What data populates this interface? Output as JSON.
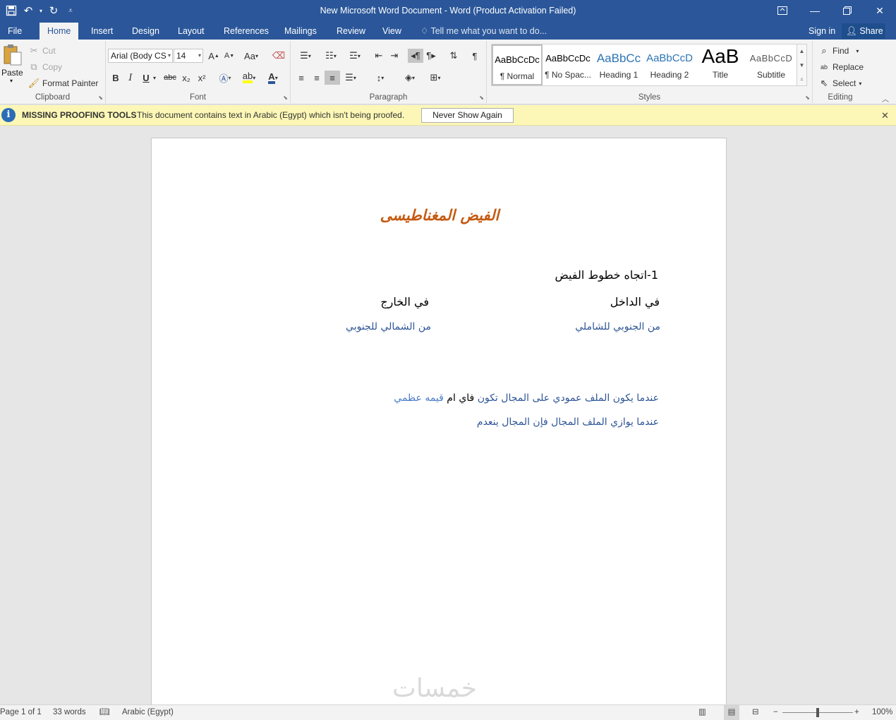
{
  "titlebar": {
    "title": "New Microsoft Word Document - Word (Product Activation Failed)",
    "qat": {
      "save_icon": "save-icon",
      "undo_icon": "undo-icon",
      "redo_icon": "redo-icon",
      "customize_icon": "customize-qat-icon"
    }
  },
  "tabs": [
    {
      "label": "File"
    },
    {
      "label": "Home"
    },
    {
      "label": "Insert"
    },
    {
      "label": "Design"
    },
    {
      "label": "Layout"
    },
    {
      "label": "References"
    },
    {
      "label": "Mailings"
    },
    {
      "label": "Review"
    },
    {
      "label": "View"
    }
  ],
  "tell_me": "Tell me what you want to do...",
  "sign_in": "Sign in",
  "share": "Share",
  "clipboard": {
    "paste": "Paste",
    "cut": "Cut",
    "copy": "Copy",
    "format_painter": "Format Painter",
    "label": "Clipboard"
  },
  "font": {
    "name": "Arial (Body CS",
    "size": "14",
    "grow": "A",
    "shrink": "A",
    "change_case": "Aa",
    "bold": "B",
    "italic": "I",
    "underline": "U",
    "strikethrough": "abc",
    "subscript": "x₂",
    "superscript": "x²",
    "label": "Font"
  },
  "paragraph": {
    "label": "Paragraph",
    "pilcrow": "¶"
  },
  "styles": {
    "label": "Styles",
    "items": [
      {
        "sample": "AaBbCcDc",
        "name": "¶ Normal"
      },
      {
        "sample": "AaBbCcDc",
        "name": "¶ No Spac..."
      },
      {
        "sample": "AaBbCc",
        "name": "Heading 1"
      },
      {
        "sample": "AaBbCcD",
        "name": "Heading 2"
      },
      {
        "sample": "AaB",
        "name": "Title"
      },
      {
        "sample": "AaBbCcD",
        "name": "Subtitle"
      }
    ]
  },
  "editing": {
    "label": "Editing",
    "find": "Find",
    "replace": "Replace",
    "select": "Select"
  },
  "infobar": {
    "title": "MISSING PROOFING TOOLS",
    "message": "This document contains text in Arabic (Egypt) which isn't being proofed.",
    "button": "Never Show Again"
  },
  "document": {
    "title": "الفيض المغناطيسى",
    "line1": "1-اتجاه خطوط الفيض",
    "inside": "في الداخل",
    "outside": "في الخارج",
    "south_to_north": "من الجنوبي للشاملي",
    "north_to_south": "من الشمالي للجنوبي",
    "line4_part1": "عندما يكون الملف عمودي على المجال تكون",
    "line4_part2": " فاي ام ",
    "line4_part3": " قيمه عظمي",
    "line5": "عندما يوازي الملف المجال فإن المجال ينعدم"
  },
  "watermark": "خمسات",
  "statusbar": {
    "page": "Page 1 of 1",
    "words": "33 words",
    "language": "Arabic (Egypt)",
    "zoom": "100%",
    "zoom_fraction": 0.5
  },
  "colors": {
    "word_blue": "#2b579a",
    "title_orange": "#c55a11",
    "text_blue": "#2e5597",
    "infobar_yellow": "#fcf7b6"
  }
}
